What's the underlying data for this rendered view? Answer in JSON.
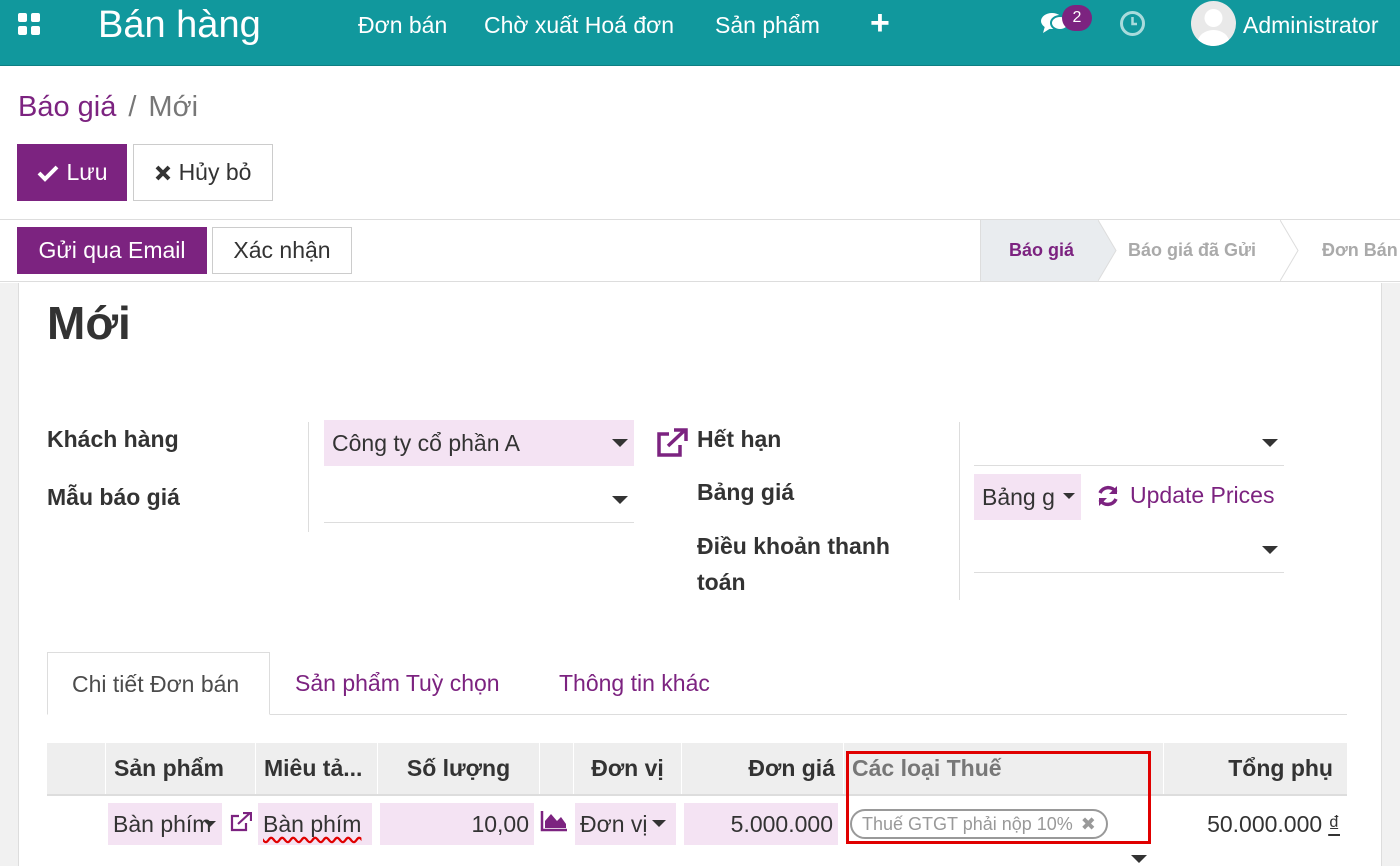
{
  "navbar": {
    "brand": "Bán hàng",
    "menu": [
      "Đơn bán",
      "Chờ xuất Hoá đơn",
      "Sản phẩm"
    ],
    "plus": "+",
    "chat_badge": "2",
    "username": "Administrator",
    "color": "#11989d"
  },
  "breadcrumb": {
    "parent": "Báo giá",
    "separator": "/",
    "current": "Mới"
  },
  "actions": {
    "save": "Lưu",
    "discard": "Hủy bỏ"
  },
  "header_buttons": {
    "send_email": "Gửi qua Email",
    "confirm": "Xác nhận"
  },
  "status_steps": [
    "Báo giá",
    "Báo giá đã Gửi",
    "Đơn Bán"
  ],
  "record": {
    "title": "Mới"
  },
  "form": {
    "customer_label": "Khách hàng",
    "customer_value": "Công ty cổ phần A",
    "template_label": "Mẫu báo giá",
    "expiry_label": "Hết hạn",
    "pricelist_label": "Bảng giá",
    "pricelist_value": "Bảng g",
    "update_prices": "Update Prices",
    "payment_terms_label_1": "Điều khoản thanh",
    "payment_terms_label_2": "toán"
  },
  "tabs": [
    "Chi tiết Đơn bán",
    "Sản phẩm Tuỳ chọn",
    "Thông tin khác"
  ],
  "table": {
    "headers": {
      "product": "Sản phẩm",
      "description": "Miêu tả...",
      "quantity": "Số lượng",
      "uom": "Đơn vị",
      "price": "Đơn giá",
      "taxes": "Các loại Thuế",
      "subtotal": "Tổng phụ"
    },
    "rows": [
      {
        "product": "Bàn phím",
        "description": "Bàn phím",
        "quantity": "10,00",
        "uom": "Đơn vị",
        "price": "5.000.000",
        "tax": "Thuế GTGT phải nộp 10%",
        "subtotal": "50.000.000",
        "currency": "₫"
      }
    ]
  },
  "colors": {
    "primary": "#7c2380",
    "highlight": "#e00000"
  }
}
